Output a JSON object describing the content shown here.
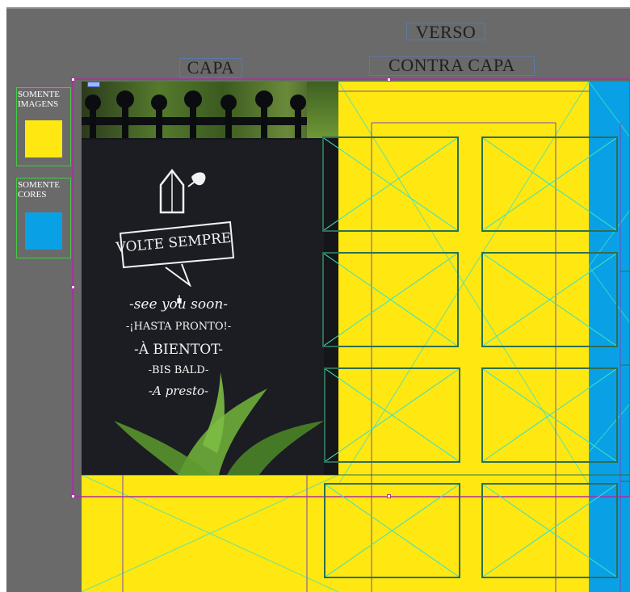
{
  "labels": {
    "verso": "VERSO",
    "capa": "CAPA",
    "contra_capa": "CONTRA CAPA"
  },
  "sidebar": {
    "images_only": "SOMENTE IMAGENS",
    "colors_only": "SOMENTE CORES"
  },
  "photo_sign": {
    "banner": "VOLTE SEMPRE",
    "lines": [
      "-see you soon-",
      "-¡HASTA PRONTO!-",
      "-À BIENTOT-",
      "-BIS BALD-",
      "-A presto-"
    ]
  },
  "colors": {
    "pasteboard": "#6a6a6a",
    "page_yellow": "#ffe812",
    "page_blue": "#0aa0e6",
    "frame_stroke": "#2f6e52",
    "guide_magenta": "#b02aa5",
    "guide_purple": "#7a46b8",
    "crossing_cyan": "#3fe0c0"
  }
}
